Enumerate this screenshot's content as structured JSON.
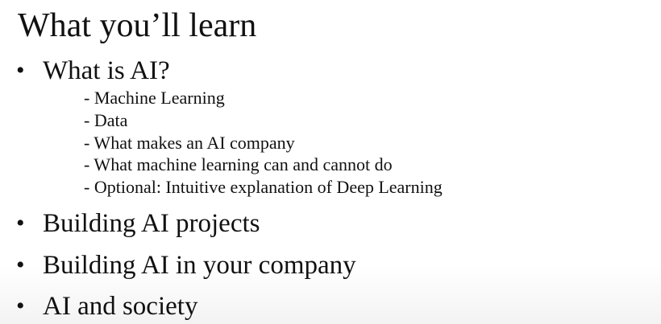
{
  "slide": {
    "title": "What you’ll learn",
    "bullet_glyph": "•",
    "items": [
      {
        "label": "What is AI?",
        "subitems": [
          "- Machine Learning",
          "- Data",
          "- What makes an AI company",
          "- What machine learning can and cannot do",
          "- Optional: Intuitive explanation of Deep Learning"
        ]
      },
      {
        "label": "Building AI projects"
      },
      {
        "label": "Building AI in your company"
      },
      {
        "label": "AI and society"
      }
    ]
  }
}
